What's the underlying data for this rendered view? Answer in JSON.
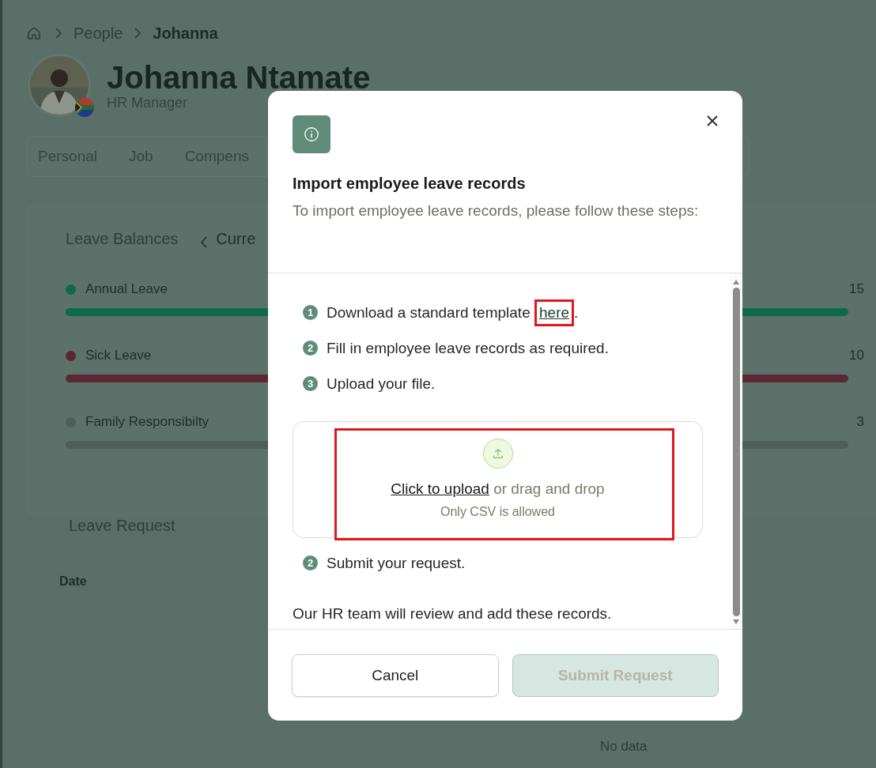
{
  "breadcrumb": [
    {
      "label": "People",
      "current": false
    },
    {
      "label": "Johanna",
      "current": true
    }
  ],
  "profile": {
    "name": "Johanna Ntamate",
    "role": "HR Manager"
  },
  "tabs": [
    {
      "label": "Personal",
      "selected": false
    },
    {
      "label": "Job",
      "selected": false
    },
    {
      "label": "Compens",
      "selected": false
    }
  ],
  "leave_balances": {
    "title": "Leave Balances",
    "period": "Curre",
    "items": [
      {
        "label": "Annual Leave",
        "color": "#0f6a4a",
        "level": 1,
        "value": "15"
      },
      {
        "label": "Sick Leave",
        "color": "#5a2834",
        "level": 1,
        "value": "10"
      },
      {
        "label": "Family Responsibilty",
        "color": "#4d5f58",
        "level": 0,
        "value": "3"
      }
    ]
  },
  "leave_request": {
    "title": "Leave Request",
    "columns": [
      "Date"
    ],
    "empty_text": "No data"
  },
  "dialog": {
    "title": "Import employee leave records",
    "description": "To import employee leave records, please follow these steps:",
    "steps": [
      {
        "number": "1",
        "text": "Download a standard template",
        "link": "here",
        "suffix": ".",
        "highlighted": true
      },
      {
        "number": "2",
        "text": "Fill in employee leave records as required."
      },
      {
        "number": "3",
        "text": "Upload your file."
      }
    ],
    "upload": {
      "link": "Click to upload",
      "text": "or drag and drop",
      "hint": "Only CSV is allowed",
      "highlighted": true
    },
    "final_step": {
      "number": "2",
      "text": "Submit your request."
    },
    "note": "Our HR team will review and add these records.",
    "buttons": [
      {
        "label": "Cancel",
        "kind": "secondary",
        "disabled": false
      },
      {
        "label": "Submit Request",
        "kind": "primary",
        "disabled": true
      }
    ]
  }
}
